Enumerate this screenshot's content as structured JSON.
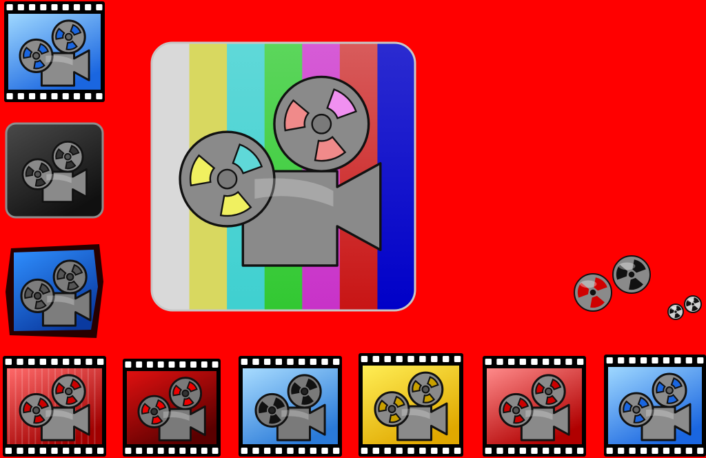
{
  "canvas": {
    "background": "#ff0000"
  },
  "hero": {
    "name": "video-camera-color-bars-icon",
    "stripes": [
      "#d9d9d9",
      "#d8d860",
      "#5fd8d8",
      "#5cd65c",
      "#d65cd6",
      "#d85c5c",
      "#2b2bd0"
    ],
    "stripes_lower": [
      "#d9d9d9",
      "#d8d860",
      "#3fd0d0",
      "#32c832",
      "#c832c8",
      "#c81414",
      "#0000c8"
    ],
    "reel_window_colors": [
      "#5fd8d8",
      "#f0f060",
      "#f090f0",
      "#f08a8a"
    ]
  },
  "palette": {
    "film_edge": "#000000",
    "sprocket": "#ffffff",
    "camera_body": "#8a8a8a",
    "camera_outline": "#111111"
  },
  "icons": [
    {
      "name": "film-camera-icon-blue-top",
      "style": "film-blue"
    },
    {
      "name": "camera-icon-gray-rounded",
      "style": "gray-tile"
    },
    {
      "name": "projector-icon-blue-ragged",
      "style": "blue-ragged"
    },
    {
      "name": "film-camera-icon-red-streaks",
      "style": "film-red-streaks"
    },
    {
      "name": "film-camera-icon-dark-red",
      "style": "film-dark-red"
    },
    {
      "name": "film-camera-icon-light-blue",
      "style": "film-light-blue"
    },
    {
      "name": "film-camera-icon-yellow",
      "style": "film-yellow"
    },
    {
      "name": "film-camera-icon-red-gradient",
      "style": "film-red-gradient"
    },
    {
      "name": "film-camera-icon-blue-right",
      "style": "film-blue"
    }
  ],
  "reels": [
    {
      "name": "film-reel-icon-large",
      "style": "dark"
    },
    {
      "name": "film-reel-icon-red-hub",
      "style": "red"
    },
    {
      "name": "film-reel-icon-small",
      "style": "gray"
    },
    {
      "name": "film-reel-icon-tiny",
      "style": "gray"
    }
  ]
}
